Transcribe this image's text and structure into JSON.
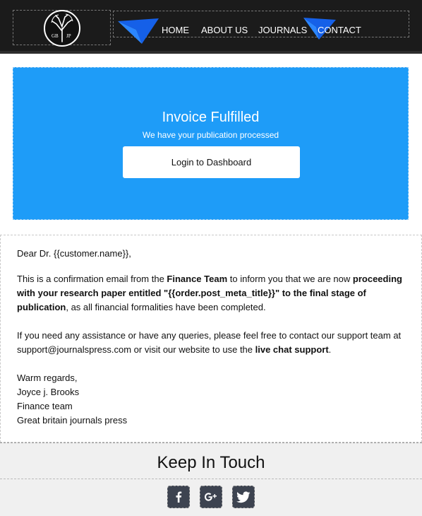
{
  "header": {
    "logo_icon": "tree-logo-icon",
    "nav": [
      "HOME",
      "ABOUT US",
      "JOURNALS",
      "CONTACT"
    ]
  },
  "hero": {
    "title": "Invoice Fulfilled",
    "subtitle": "We have your publication processed",
    "button_label": "Login to Dashboard",
    "bg_color": "#1e9cf8"
  },
  "body": {
    "greeting": "Dear Dr. {{customer.name}},",
    "para1_a": "This is a confirmation email from the ",
    "para1_b": "Finance Team",
    "para1_c": " to inform you that we are now ",
    "para1_d": "proceeding with your research paper entitled \"{{order.post_meta_title}}\" to the final stage of publication",
    "para1_e": ", as all financial formalities have been completed.",
    "para2_a": "If you need any assistance or have any queries, please feel free to contact our support team at support@journalspress.com or visit our website to use the ",
    "para2_b": "live chat support",
    "para2_c": ".",
    "sign_1": "Warm regards,",
    "sign_2": "Joyce j. Brooks",
    "sign_3": "Finance team",
    "sign_4": "Great britain journals press"
  },
  "footer": {
    "title": "Keep In Touch",
    "social_icons": [
      "facebook-icon",
      "google-plus-icon",
      "twitter-icon"
    ]
  }
}
